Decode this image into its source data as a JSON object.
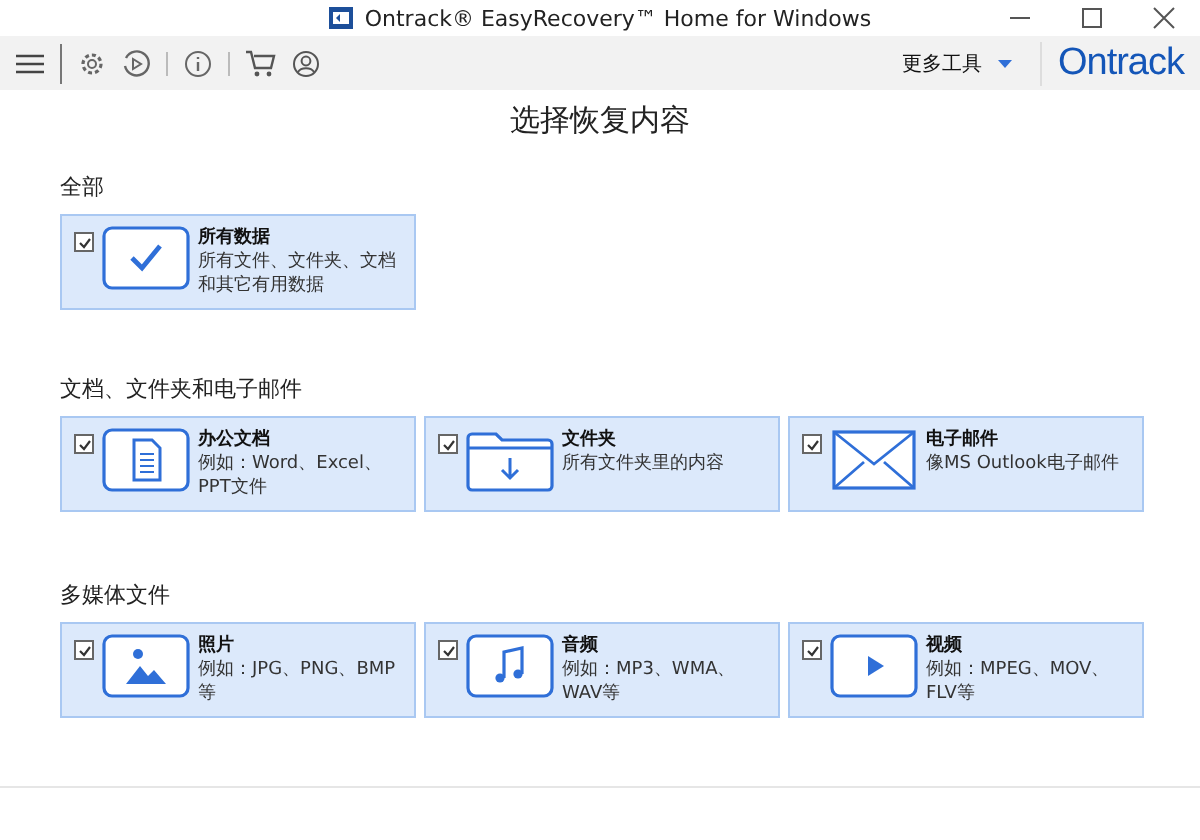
{
  "window": {
    "title": "Ontrack® EasyRecovery™ Home for Windows"
  },
  "toolbar": {
    "more_tools": "更多工具",
    "logo": "Ontrack"
  },
  "heading": "选择恢复内容",
  "sections": [
    {
      "title": "全部",
      "items": [
        {
          "kind": "all",
          "name": "所有数据",
          "description": "所有文件、文件夹、文档和其它有用数据",
          "checked": true
        }
      ]
    },
    {
      "title": "文档、文件夹和电子邮件",
      "items": [
        {
          "kind": "document",
          "name": "办公文档",
          "description": "例如：Word、Excel、PPT文件",
          "checked": true
        },
        {
          "kind": "folder",
          "name": "文件夹",
          "description": "所有文件夹里的内容",
          "checked": true
        },
        {
          "kind": "email",
          "name": "电子邮件",
          "description": "像MS Outlook电子邮件",
          "checked": true
        }
      ]
    },
    {
      "title": "多媒体文件",
      "items": [
        {
          "kind": "photo",
          "name": "照片",
          "description": "例如：JPG、PNG、BMP等",
          "checked": true
        },
        {
          "kind": "audio",
          "name": "音频",
          "description": "例如：MP3、WMA、WAV等",
          "checked": true
        },
        {
          "kind": "video",
          "name": "视频",
          "description": "例如：MPEG、MOV、FLV等",
          "checked": true
        }
      ]
    }
  ]
}
